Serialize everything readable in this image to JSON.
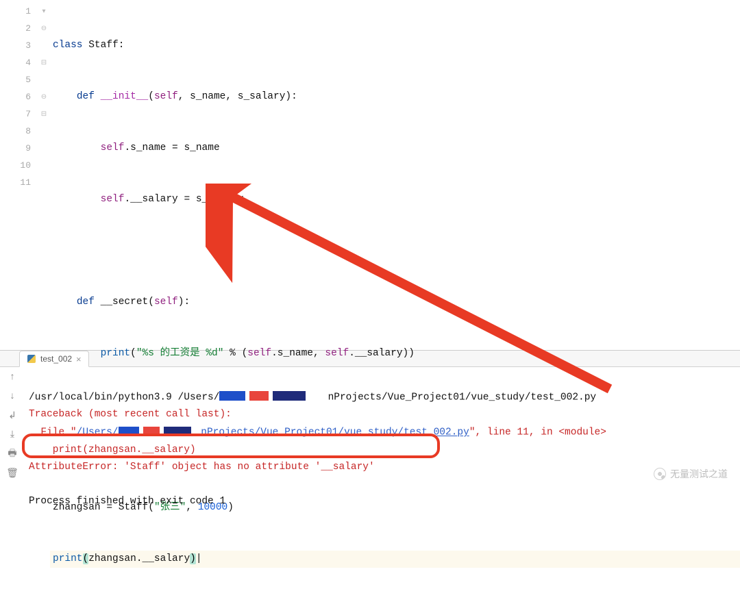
{
  "editor": {
    "lines": [
      "1",
      "2",
      "3",
      "4",
      "5",
      "6",
      "7",
      "8",
      "9",
      "10",
      "11"
    ],
    "code": {
      "l1_class": "class",
      "l1_name": " Staff:",
      "l2_def": "def",
      "l2_init": "__init__",
      "l2_args_open": "(",
      "l2_self": "self",
      "l2_args_rest": ", s_name, s_salary):",
      "l3_self": "self",
      "l3_rest": ".s_name = s_name",
      "l4_self": "self",
      "l4_rest": ".__salary = s_salary",
      "l6_def": "def",
      "l6_name": " __secret(",
      "l6_self": "self",
      "l6_close": "):",
      "l7_print": "print",
      "l7_op": "(",
      "l7_str": "\"%s 的工资是 %d\"",
      "l7_mid": " % (",
      "l7_self1": "self",
      "l7_a": ".s_name, ",
      "l7_self2": "self",
      "l7_b": ".__salary))",
      "l10_a": "zhangsan = Staff(",
      "l10_str": "\"张三\"",
      "l10_c": ", ",
      "l10_num": "10000",
      "l10_d": ")",
      "l11_print": "print",
      "l11_op": "(",
      "l11_mid": "zhangsan.__salary",
      "l11_cl": ")"
    }
  },
  "tab": {
    "name": "test_002"
  },
  "console": {
    "line1_a": "/usr/local/bin/python3.9 /Users/",
    "line1_b": "nProjects/Vue_Project01/vue_study/test_002.py",
    "trace": "Traceback (most recent call last):",
    "file_a": "  File \"",
    "file_link": "/Users/",
    "file_link2": "nProjects/Vue_Project01/vue_study/test_002.py",
    "file_b": "\", line 11, in <module>",
    "replay": "    print(zhangsan.__salary)",
    "err": "AttributeError: 'Staff' object has no attribute '__salary'",
    "exit": "Process finished with exit code 1"
  },
  "watermark": "无量测试之道"
}
